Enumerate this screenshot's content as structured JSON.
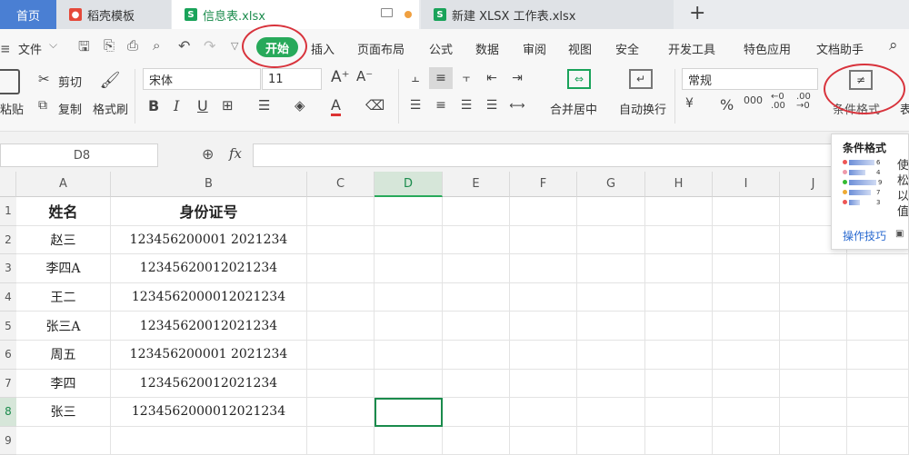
{
  "tabs": {
    "home": "首页",
    "daoke": "稻壳模板",
    "xinxi": "信息表.xlsx",
    "xinjian": "新建 XLSX 工作表.xlsx",
    "add": "+"
  },
  "menu": {
    "file": "文件",
    "start": "开始",
    "items": [
      "插入",
      "页面布局",
      "公式",
      "数据",
      "审阅",
      "视图",
      "安全",
      "开发工具",
      "特色应用",
      "文档助手"
    ]
  },
  "ribbon": {
    "paste": "粘贴",
    "cut": "剪切",
    "copy": "复制",
    "format_painter": "格式刷",
    "font_name": "宋体",
    "font_size": "11",
    "merge_center": "合并居中",
    "wrap_text": "自动换行",
    "number_format": "常规",
    "conditional_format": "条件格式",
    "table_style_partial": "表"
  },
  "formula_bar": {
    "name_box": "D8",
    "fx": "fx"
  },
  "sheet": {
    "columns": [
      "A",
      "B",
      "C",
      "D",
      "E",
      "F",
      "G",
      "H",
      "I",
      "J"
    ],
    "rows": [
      {
        "num": "1",
        "name": "姓名",
        "id": "身份证号"
      },
      {
        "num": "2",
        "name": "赵三",
        "id": "123456200001 2021234"
      },
      {
        "num": "3",
        "name": "李四A",
        "id": "12345620012021234"
      },
      {
        "num": "4",
        "name": "王二",
        "id": "1234562000012021234"
      },
      {
        "num": "5",
        "name": "张三A",
        "id": "12345620012021234"
      },
      {
        "num": "6",
        "name": "周五",
        "id": "123456200001 2021234"
      },
      {
        "num": "7",
        "name": "李四",
        "id": "12345620012021234"
      },
      {
        "num": "8",
        "name": "张三",
        "id": "1234562000012021234"
      },
      {
        "num": "9",
        "name": "",
        "id": ""
      }
    ]
  },
  "tooltip": {
    "title": "条件格式",
    "desc_chars": [
      "使",
      "松",
      "以",
      "值"
    ],
    "tips_link": "操作技巧",
    "bar_values": [
      "6",
      "4",
      "9",
      "7",
      "3"
    ]
  },
  "colors": {
    "accent_green": "#27a95a",
    "tab_blue": "#4a7fd3",
    "highlight_red": "#d8333c"
  }
}
